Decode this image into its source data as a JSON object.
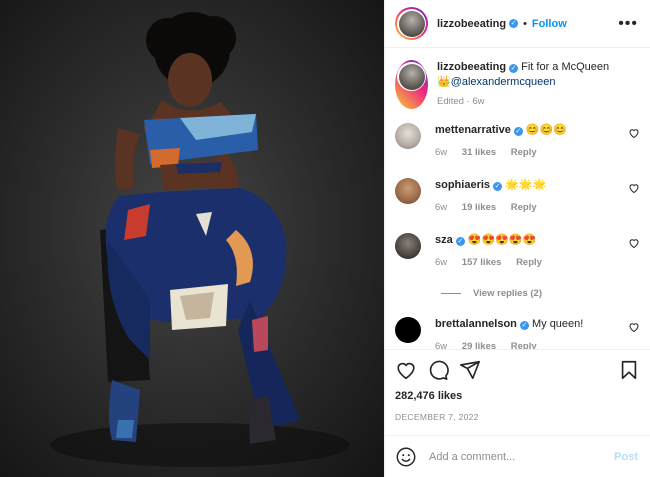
{
  "header": {
    "username": "lizzobeeating",
    "verified": true,
    "separator": "•",
    "follow_label": "Follow",
    "more_icon": "more-horizontal-icon"
  },
  "caption": {
    "username": "lizzobeeating",
    "text": "Fit for a McQueen",
    "emoji": "👑",
    "mention": "@alexandermcqueen",
    "meta": "Edited · 6w"
  },
  "comments": [
    {
      "username": "mettenarrative",
      "verified": true,
      "text": "😊😊😊",
      "age": "6w",
      "likes": "31 likes",
      "reply": "Reply",
      "avatar_color": "#c9c3bd"
    },
    {
      "username": "sophiaeris",
      "verified": true,
      "text": "🌟🌟🌟",
      "age": "6w",
      "likes": "19 likes",
      "reply": "Reply",
      "avatar_color": "#a97a5a"
    },
    {
      "username": "sza",
      "verified": true,
      "text": "😍😍😍😍😍",
      "age": "6w",
      "likes": "157 likes",
      "reply": "Reply",
      "avatar_color": "#4a4440",
      "view_replies": "View replies (2)"
    },
    {
      "username": "brettalannelson",
      "verified": true,
      "text": "My queen!",
      "age": "6w",
      "likes": "29 likes",
      "reply": "Reply",
      "avatar_color": "#000000"
    }
  ],
  "post": {
    "likes": "282,476 likes",
    "date": "DECEMBER 7, 2022"
  },
  "add_comment": {
    "placeholder": "Add a comment...",
    "post_label": "Post"
  },
  "colors": {
    "accent": "#0095f6",
    "verified": "#3897f0",
    "muted": "#8e8e8e",
    "post_disabled": "#b2dffc"
  }
}
